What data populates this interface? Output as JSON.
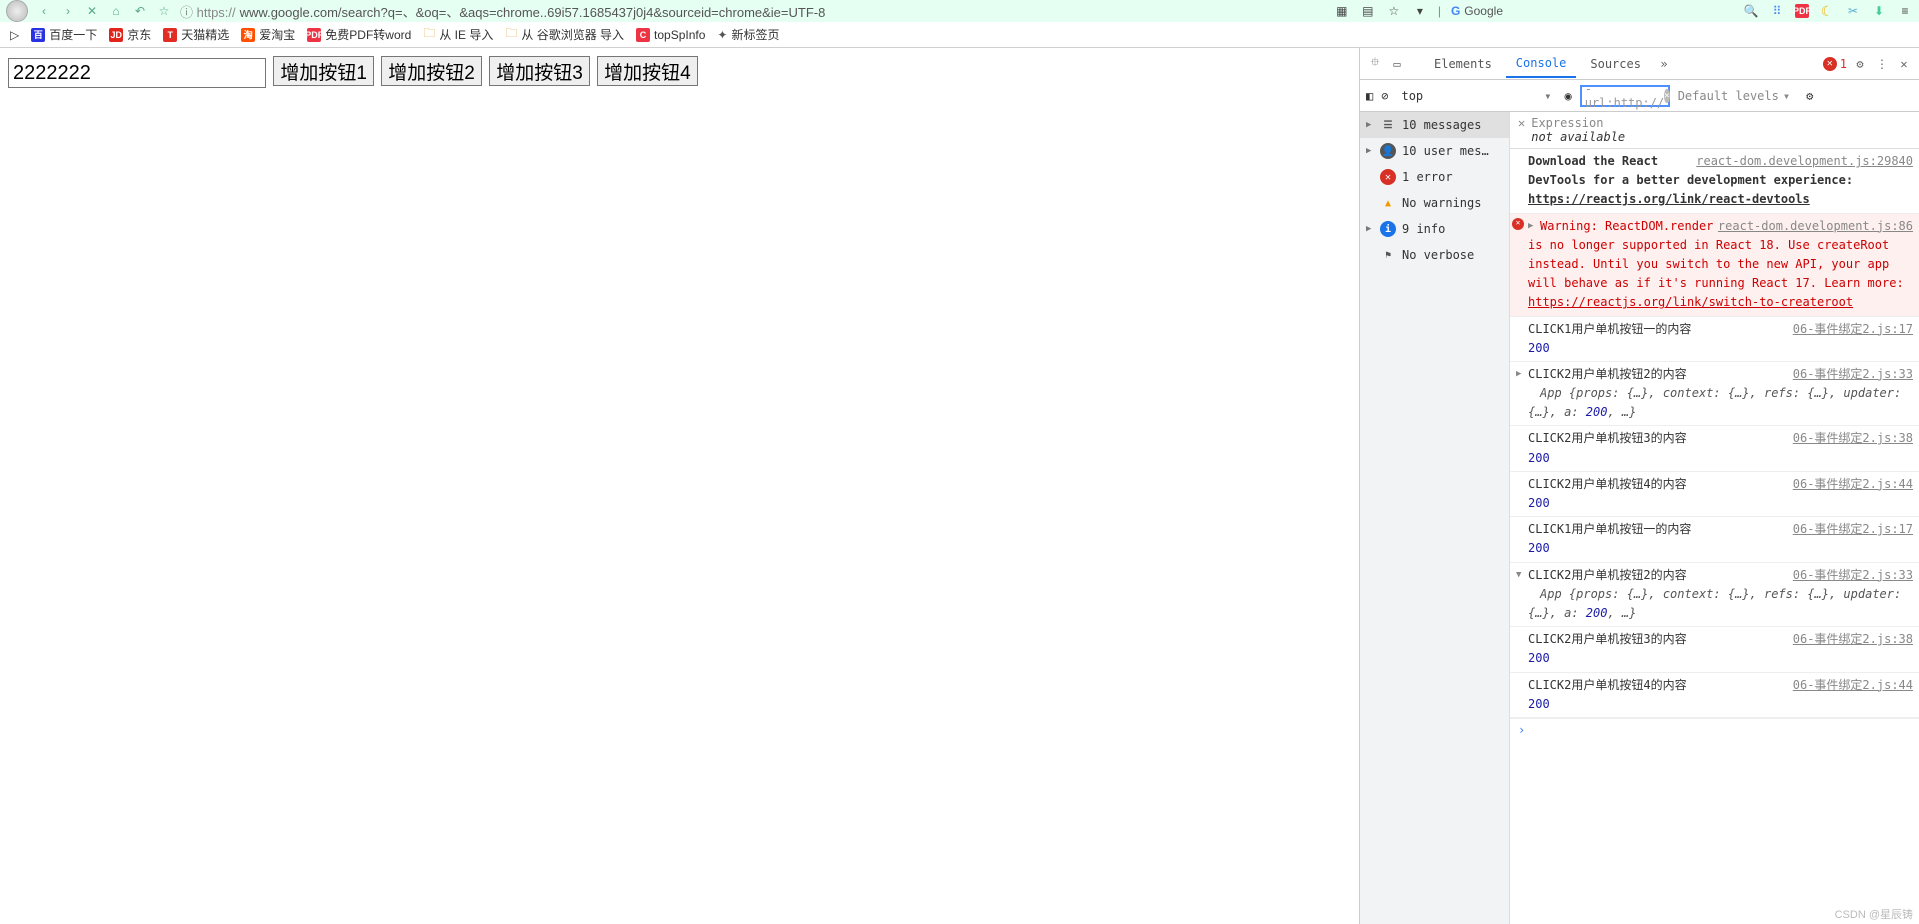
{
  "browser": {
    "url_proto": "ⓘ https://",
    "url_rest": "www.google.com/search?q=、&oq=、&aqs=chrome..69i57.1685437j0j4&sourceid=chrome&ie=UTF-8",
    "search_label": "Google"
  },
  "bookmarks": {
    "b1": "百度一下",
    "b2": "京东",
    "b3": "天猫精选",
    "b4": "爱淘宝",
    "b5": "免费PDF转word",
    "b6": "从 IE 导入",
    "b7": "从 谷歌浏览器 导入",
    "b8": "topSpInfo",
    "b9": "新标签页"
  },
  "page": {
    "input_value": "2222222",
    "btn1": "增加按钮1",
    "btn2": "增加按钮2",
    "btn3": "增加按钮3",
    "btn4": "增加按钮4"
  },
  "devtools": {
    "tabs": {
      "elements": "Elements",
      "console": "Console",
      "sources": "Sources"
    },
    "error_count": "1",
    "context": "top",
    "filter_value": "-url:http://",
    "levels": "Default levels",
    "sidebar": {
      "messages": "10 messages",
      "user": "10 user mes…",
      "errors": "1 error",
      "warnings": "No warnings",
      "info": "9 info",
      "verbose": "No verbose"
    },
    "expression": {
      "label": "Expression",
      "value": "not available"
    },
    "log0_src": "react-dom.development.js:29840",
    "log0_a": "Download the React DevTools for a better development experience: ",
    "log0_b": "https://reactjs.org/link/react-devtools",
    "log1_src": "react-dom.development.js:86",
    "log1_a": "Warning: ReactDOM.render is no longer supported in React 18. Use createRoot instead. Until you switch to the new API, your app will behave as if it's running React 17. Learn more: ",
    "log1_b": "https://reactjs.org/link/switch-to-createroot",
    "rows": [
      {
        "msg": "CLICK1用户单机按钮一的内容",
        "src": "06-事件绑定2.js:17",
        "num": "200",
        "obj": ""
      },
      {
        "msg": "CLICK2用户单机按钮2的内容",
        "src": "06-事件绑定2.js:33",
        "num": "",
        "obj": "App {props: {…}, context: {…}, refs: {…}, updater: {…}, a: 200, …}",
        "tri": "▶"
      },
      {
        "msg": "CLICK2用户单机按钮3的内容",
        "src": "06-事件绑定2.js:38",
        "num": "200",
        "obj": ""
      },
      {
        "msg": "CLICK2用户单机按钮4的内容",
        "src": "06-事件绑定2.js:44",
        "num": "200",
        "obj": ""
      },
      {
        "msg": "CLICK1用户单机按钮一的内容",
        "src": "06-事件绑定2.js:17",
        "num": "200",
        "obj": ""
      },
      {
        "msg": "CLICK2用户单机按钮2的内容",
        "src": "06-事件绑定2.js:33",
        "num": "",
        "obj": "App {props: {…}, context: {…}, refs: {…}, updater: {…}, a: 200, …}",
        "tri": "▼"
      },
      {
        "msg": "CLICK2用户单机按钮3的内容",
        "src": "06-事件绑定2.js:38",
        "num": "200",
        "obj": ""
      },
      {
        "msg": "CLICK2用户单机按钮4的内容",
        "src": "06-事件绑定2.js:44",
        "num": "200",
        "obj": ""
      }
    ]
  },
  "watermark": "CSDN @星辰铸"
}
